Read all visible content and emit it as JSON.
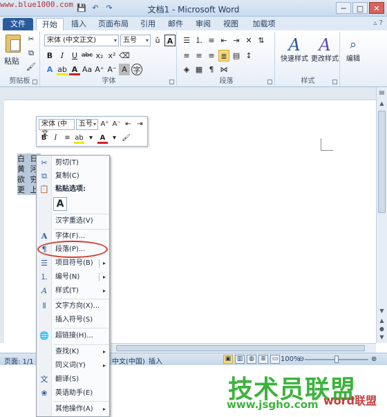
{
  "window": {
    "title": "文档1 - Microsoft Word",
    "watermark": "www.blue1000.com",
    "qat_icons": [
      "save-icon",
      "undo-icon",
      "redo-icon"
    ],
    "buttons": [
      "─",
      "□",
      "✕"
    ]
  },
  "tabs": [
    {
      "label": "文件"
    },
    {
      "label": "开始"
    },
    {
      "label": "插入"
    },
    {
      "label": "页面布局"
    },
    {
      "label": "引用"
    },
    {
      "label": "邮件"
    },
    {
      "label": "审阅"
    },
    {
      "label": "视图"
    },
    {
      "label": "加载项"
    }
  ],
  "ribbon": {
    "clipboard": {
      "paste": "粘贴",
      "label": "剪贴板"
    },
    "font": {
      "name": "宋体 (中文正文)",
      "size": "五号",
      "label": "字体"
    },
    "paragraph": {
      "label": "段落"
    },
    "styles": {
      "quick": "快速样式",
      "change": "更改样式",
      "label": "样式"
    },
    "edit": {
      "label": "编辑"
    }
  },
  "document": {
    "lines": [
      "白 日",
      "黄 河",
      "欲 穷",
      "更 上"
    ]
  },
  "mini_toolbar": {
    "font": "宋体 (中文",
    "size": "五号"
  },
  "context_menu": {
    "cut": "剪切(T)",
    "copy": "复制(C)",
    "paste_options": "粘贴选项:",
    "paste_keep": "A",
    "reconvert": "汉字重选(V)",
    "font": "字体(F)...",
    "paragraph": "段落(P)...",
    "bullets": "项目符号(B)",
    "numbering": "编号(N)",
    "styles": "样式(T)",
    "text_direction": "文字方向(X)...",
    "insert_symbol": "插入符号(S)",
    "hyperlink": "超链接(H)...",
    "lookup": "查找(K)",
    "synonyms": "同义词(Y)",
    "translate": "翻译(S)",
    "english_assistant": "英语助手(E)",
    "more_actions": "其他操作(A)"
  },
  "status": {
    "page": "页面: 1/1",
    "language": "中文(中国)",
    "insert_mode": "插入",
    "zoom": "100%"
  },
  "brand": {
    "name": "技术员联盟",
    "url": "www.jsgho.com",
    "sub": "word联盟"
  },
  "colors": {
    "accent": "#2a5b9e",
    "highlight": "#fbd877",
    "annotation": "#d23c2a",
    "brand": "#3cb33c"
  }
}
